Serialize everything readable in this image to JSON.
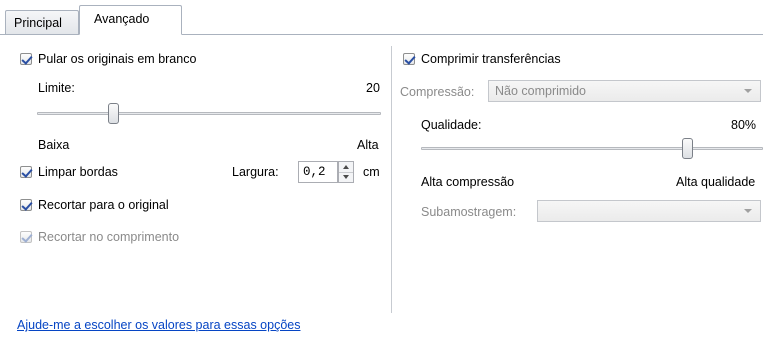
{
  "tabs": [
    {
      "label": "Principal",
      "active": false
    },
    {
      "label": "Avançado",
      "active": true
    }
  ],
  "left": {
    "skip_blank": {
      "label": "Pular os originais em branco",
      "checked": true
    },
    "threshold": {
      "label": "Limite:",
      "value": "20",
      "low_label": "Baixa",
      "high_label": "Alta",
      "level": 0.2
    },
    "clean_edges": {
      "label": "Limpar bordas",
      "checked": true
    },
    "width": {
      "label": "Largura:",
      "value": "0,2",
      "unit": "cm"
    },
    "crop_original": {
      "label": "Recortar para o original",
      "checked": true
    },
    "crop_length": {
      "label": "Recortar no comprimento",
      "checked": true,
      "disabled": true
    }
  },
  "right": {
    "compress": {
      "label": "Comprimir transferências",
      "checked": true
    },
    "compression": {
      "label": "Compressão:",
      "value": "Não comprimido",
      "disabled": true
    },
    "quality": {
      "label": "Qualidade:",
      "value": "80%",
      "low_label": "Alta compressão",
      "high_label": "Alta qualidade",
      "level": 0.8
    },
    "subsampling": {
      "label": "Subamostragem:",
      "value": "",
      "disabled": true
    }
  },
  "help_link": "Ajude-me a escolher os valores para essas opções"
}
